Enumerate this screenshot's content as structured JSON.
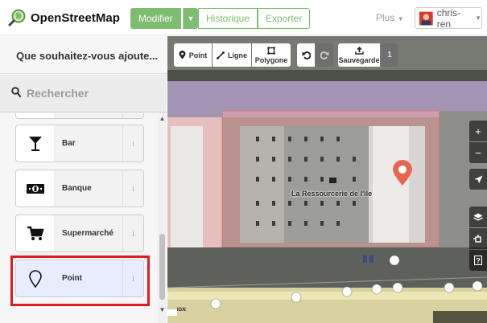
{
  "topbar": {
    "logo_text": "OpenStreetMap",
    "edit_label": "Modifier",
    "history_label": "Historique",
    "export_label": "Exporter",
    "more_label": "Plus",
    "username": "chris-ren"
  },
  "sidebar": {
    "title": "Que souhaitez-vous ajoute...",
    "search_placeholder": "Rechercher",
    "presets": [
      {
        "label": "Bar",
        "icon": "cocktail-glass-icon",
        "info": "i"
      },
      {
        "label": "Banque",
        "icon": "banknote-icon",
        "info": "i"
      },
      {
        "label": "Supermarché",
        "icon": "shopping-cart-icon",
        "info": "i"
      },
      {
        "label": "Point",
        "icon": "map-pin-icon",
        "info": "i",
        "selected": true
      }
    ]
  },
  "toolbar": {
    "point_label": "Point",
    "line_label": "Ligne",
    "polygon_label": "Polygone",
    "save_label": "Sauvegarde",
    "save_count": "1"
  },
  "map": {
    "place_label": "La Ressourcerie de l'île",
    "attribution": "IGN"
  },
  "colors": {
    "accent_green": "#7ebc6f",
    "highlight_red": "#e01b24",
    "selected_bg": "#e8ecff",
    "building_fill": "#f3a6a6",
    "pin_color": "#e8664f"
  }
}
